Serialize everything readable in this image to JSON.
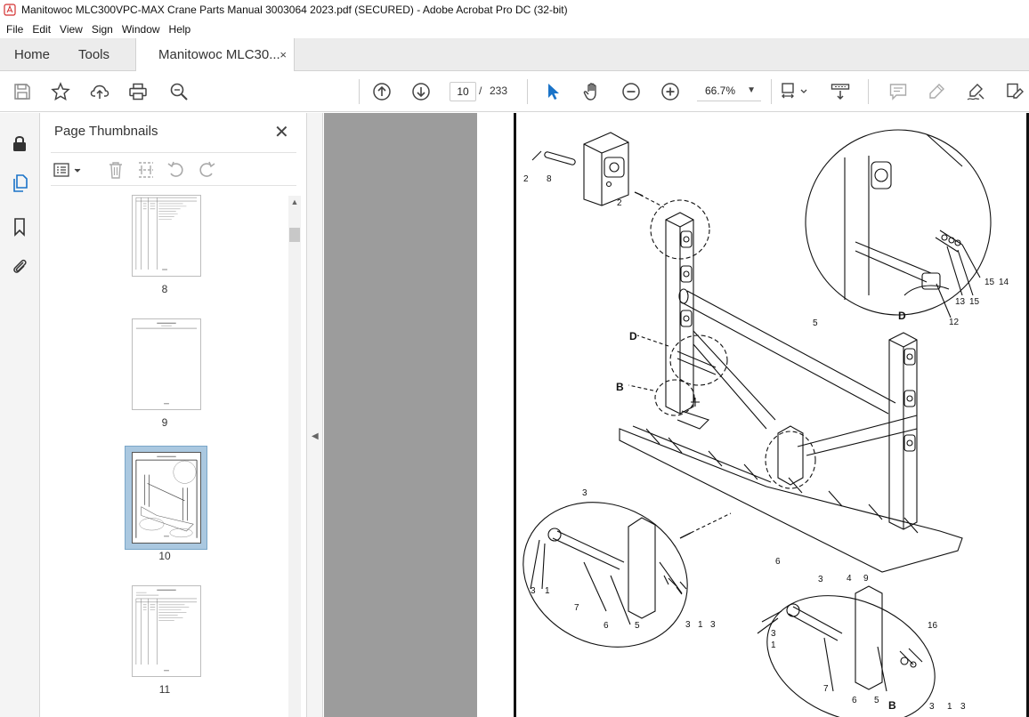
{
  "window": {
    "title": "Manitowoc MLC300VPC-MAX Crane Parts Manual 3003064 2023.pdf (SECURED) - Adobe Acrobat Pro DC (32-bit)",
    "app_icon": "acrobat-icon"
  },
  "menu": [
    "File",
    "Edit",
    "View",
    "Sign",
    "Window",
    "Help"
  ],
  "tabs": {
    "home": "Home",
    "tools": "Tools",
    "document": "Manitowoc MLC30...",
    "close": "×"
  },
  "toolbar": {
    "icons": [
      "save-icon",
      "star-icon",
      "upload-icon",
      "print-icon",
      "find-icon",
      "page-up-icon",
      "page-down-icon",
      "select-cursor-icon",
      "hand-icon",
      "zoom-out-icon",
      "zoom-in-icon",
      "fit-page-icon",
      "scroll-mode-icon",
      "comment-icon",
      "highlight-icon",
      "sign-icon",
      "edit-icon"
    ],
    "current_page": "10",
    "page_sep": "/",
    "total_pages": "233",
    "zoom": "66.7%"
  },
  "thumbnails_panel": {
    "title": "Page Thumbnails",
    "close": "✕",
    "pages": [
      {
        "label": "8",
        "selected": false
      },
      {
        "label": "9",
        "selected": false
      },
      {
        "label": "10",
        "selected": true
      },
      {
        "label": "11",
        "selected": false
      }
    ]
  },
  "drawing": {
    "callouts": [
      "2",
      "8",
      "2",
      "D",
      "B",
      "5",
      "D",
      "13",
      "15",
      "15",
      "14",
      "12",
      "3",
      "3",
      "1",
      "7",
      "6",
      "5",
      "3",
      "1",
      "3",
      "6",
      "3",
      "4",
      "9",
      "3",
      "1",
      "16",
      "7",
      "6",
      "5",
      "B",
      "3",
      "1",
      "3"
    ]
  }
}
